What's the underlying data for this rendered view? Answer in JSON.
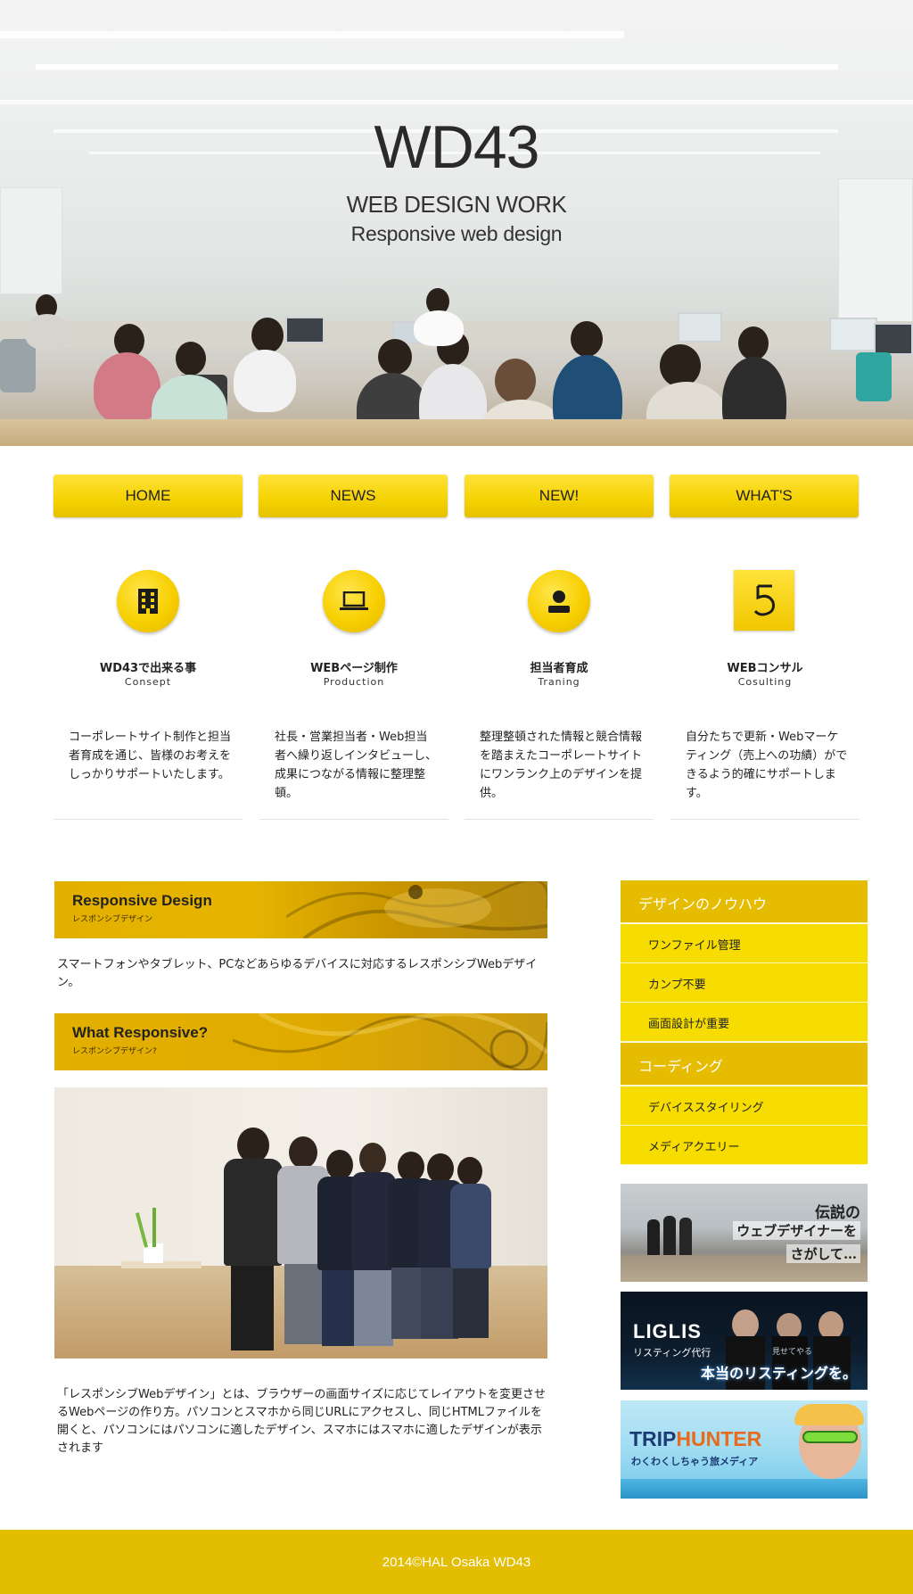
{
  "hero": {
    "title": "WD43",
    "subtitle_1": "WEB DESIGN WORK",
    "subtitle_2": "Responsive web design"
  },
  "nav": {
    "items": [
      "HOME",
      "NEWS",
      "NEW!",
      "WHAT'S"
    ]
  },
  "features": [
    {
      "icon": "building-icon",
      "title": "WD43で出来る事",
      "subtitle": "Consept",
      "text": "コーポレートサイト制作と担当者育成を通じ、皆様のお考えをしっかりサポートいたします。"
    },
    {
      "icon": "laptop-icon",
      "title": "WEBページ制作",
      "subtitle": "Production",
      "text": "社長・営業担当者・Web担当者へ繰り返しインタビューし、成果につながる情報に整理整頓。"
    },
    {
      "icon": "person-icon",
      "title": "担当者育成",
      "subtitle": "Traning",
      "text": "整理整頓された情報と競合情報を踏まえたコーポレートサイトにワンランク上のデザインを提供。"
    },
    {
      "icon": "number-five-icon",
      "title": "WEBコンサル",
      "subtitle": "Cosulting",
      "text": "自分たちで更新・Webマーケティング（売上への功績）ができるよう的確にサポートします。"
    }
  ],
  "main": {
    "section1": {
      "title": "Responsive Design",
      "subtitle": "レスポンシブデザイン",
      "text": "スマートフォンやタブレット、PCなどあらゆるデバイスに対応するレスポンシブWebデザイン。"
    },
    "section2": {
      "title": "What Responsive?",
      "subtitle": "レスポンシブデザイン?",
      "text": "「レスポンシブWebデザイン」とは、ブラウザーの画面サイズに応じてレイアウトを変更させるWebページの作り方。パソコンとスマホから同じURLにアクセスし、同じHTMLファイルを開くと、パソコンにはパソコンに適したデザイン、スマホにはスマホに適したデザインが表示されます"
    }
  },
  "sidebar": {
    "groups": [
      {
        "heading": "デザインのノウハウ",
        "items": [
          "ワンファイル管理",
          "カンプ不要",
          "画面設計が重要"
        ]
      },
      {
        "heading": "コーディング",
        "items": [
          "デバイススタイリング",
          "メディアクエリー"
        ]
      }
    ],
    "ads": [
      {
        "lines": [
          "伝説の",
          "ウェブデザイナーを",
          "さがして…"
        ]
      },
      {
        "brand": "LIGLIS",
        "tag": "リスティング代行",
        "small": "見せてやる",
        "headline": "本当のリスティングを。"
      },
      {
        "brand_a": "TRIP",
        "brand_b": "HUNTER",
        "tag": "わくわくしちゃう旅メディア"
      }
    ]
  },
  "footer": {
    "text": "2014©HAL Osaka WD43"
  },
  "colors": {
    "accent": "#f5d200",
    "accent_dark": "#e3bd00",
    "sidebar_head": "#e6bc00",
    "sidebar_item": "#f7dc00"
  }
}
